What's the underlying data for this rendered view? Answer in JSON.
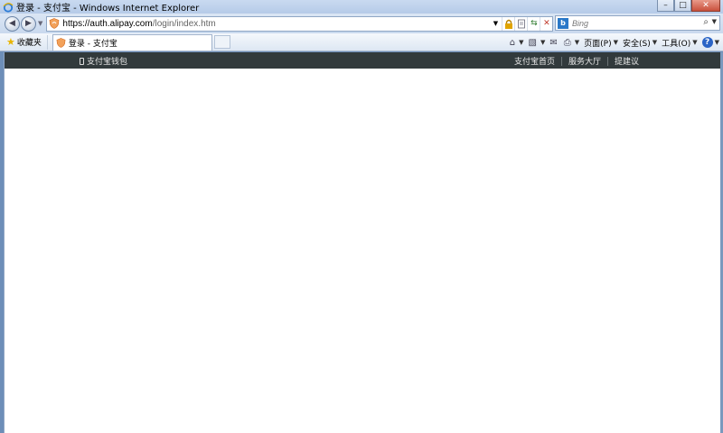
{
  "window": {
    "title": "登录 - 支付宝 - Windows Internet Explorer",
    "controls": {
      "minimize": "–",
      "maximize": "□",
      "close": "✕"
    }
  },
  "nav": {
    "back_glyph": "◀",
    "forward_glyph": "▶",
    "url_host": "https://auth.alipay.com",
    "url_rest": "/login/index.htm",
    "search_placeholder": "Bing",
    "search_glyph": "⌕"
  },
  "favorites": {
    "label": "收藏夹"
  },
  "tab": {
    "label": "登录 - 支付宝"
  },
  "commands": {
    "page": "页面(P)",
    "safety": "安全(S)",
    "tools": "工具(O)",
    "help": "?"
  },
  "site": {
    "wallet_label": "支付宝钱包",
    "links": [
      "支付宝首页",
      "服务大厅",
      "提建议"
    ]
  },
  "colors": {
    "site_topbar": "#323a3c",
    "lock": "#e0a400",
    "stop": "#c0392b"
  }
}
